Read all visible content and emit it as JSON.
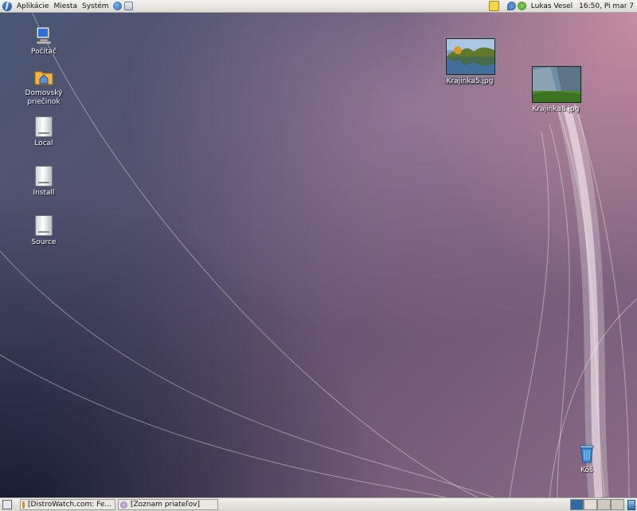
{
  "top_panel": {
    "logo_icon": "fedora-logo-icon",
    "menus": [
      "Aplikácie",
      "Miesta",
      "Systém"
    ],
    "launchers": [
      "web-browser-icon",
      "mail-client-icon"
    ],
    "tray": [
      "notes-icon",
      "network-icon",
      "messenger-icon"
    ],
    "user": "Lukas Vesel",
    "clock": "16:50, Pi mar  7"
  },
  "desktop": {
    "icons": [
      {
        "name": "computer-icon",
        "label": "Počítač"
      },
      {
        "name": "home-folder-icon",
        "label": "Domovský priečinok"
      },
      {
        "name": "drive-icon",
        "label": "Local"
      },
      {
        "name": "drive-icon",
        "label": "Install"
      },
      {
        "name": "drive-icon",
        "label": "Source"
      }
    ],
    "files": [
      {
        "name": "image-thumbnail",
        "label": "Krajinka5.jpg"
      },
      {
        "name": "image-thumbnail",
        "label": "Krajinka8.jpg"
      }
    ],
    "trash": {
      "name": "trash-icon",
      "label": "Kôš"
    }
  },
  "bottom_panel": {
    "tasks": [
      {
        "label": "[DistroWatch.com: Fe..."
      },
      {
        "label": "[Zoznam priateľov]"
      }
    ],
    "workspaces": 4,
    "active_workspace": 1
  },
  "colors": {
    "panel": "#dcdad5",
    "wallpaper_dark": "#0a1428",
    "wallpaper_pink": "#d696aa"
  }
}
